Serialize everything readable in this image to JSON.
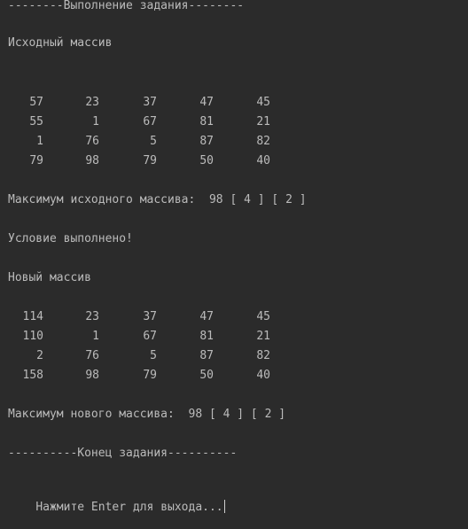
{
  "console": {
    "header": "--------Выполнение задания--------",
    "source_title": "Исходный массив",
    "source_matrix": [
      [
        "57",
        "23",
        "37",
        "47",
        "45"
      ],
      [
        "55",
        "1",
        "67",
        "81",
        "21"
      ],
      [
        "1",
        "76",
        "5",
        "87",
        "82"
      ],
      [
        "79",
        "98",
        "79",
        "50",
        "40"
      ]
    ],
    "source_max": "Максимум исходного массива:  98 [ 4 ] [ 2 ]",
    "condition": "Условие выполнено!",
    "new_title": "Новый массив",
    "new_matrix": [
      [
        "114",
        "23",
        "37",
        "47",
        "45"
      ],
      [
        "110",
        "1",
        "67",
        "81",
        "21"
      ],
      [
        "2",
        "76",
        "5",
        "87",
        "82"
      ],
      [
        "158",
        "98",
        "79",
        "50",
        "40"
      ]
    ],
    "new_max": "Максимум нового массива:  98 [ 4 ] [ 2 ]",
    "footer": "----------Конец задания----------",
    "prompt": "Нажмите Enter для выхода..."
  },
  "colors": {
    "background": "#2b2b2b",
    "text": "#bbbbbb"
  }
}
